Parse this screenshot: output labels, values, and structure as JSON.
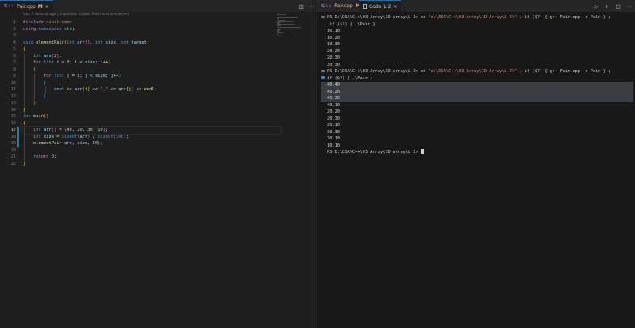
{
  "editor": {
    "tab": {
      "title": "Pair.cpp",
      "badge": "M",
      "lang_label": "C++"
    },
    "blame": "You, 1 second ago | 2 authors (Ujjwal Patel and one other)",
    "line_numbers": [
      "1",
      "2",
      "3",
      "4",
      "5",
      "6",
      "7",
      "8",
      "9",
      "10",
      "11",
      "12",
      "13",
      "14",
      "15",
      "16",
      "17",
      "18",
      "19",
      "20",
      "21",
      "22"
    ],
    "code": {
      "l1_a": "#include",
      "l1_b": " <iostream>",
      "l2_a": "using",
      "l2_b": " namespace",
      "l2_c": " std",
      "l4_a": "void",
      "l4_b": " elementPair",
      "l4_c": "int",
      "l4_d": " arr",
      "l4_e": "int",
      "l4_f": " size",
      "l4_g": "int",
      "l4_h": " target",
      "l6_a": "int",
      "l6_b": " ans",
      "l6_c": "2",
      "l7_a": "for",
      "l7_b": "int",
      "l7_c": " i",
      "l7_d": "0",
      "l7_e": " i",
      "l7_f": " size",
      "l7_g": " i",
      "l9_a": "for",
      "l9_b": "int",
      "l9_c": " j",
      "l9_d": " i",
      "l9_e": " j",
      "l9_f": " size",
      "l9_g": " j",
      "l11_a": "cout",
      "l11_b": " arr",
      "l11_c": "i",
      "l11_d": " \",\"",
      "l11_e": " arr",
      "l11_f": "j",
      "l11_g": " endl",
      "l15_a": "int",
      "l15_b": " main",
      "l17_a": "int",
      "l17_b": " arr",
      "l17_c": "40",
      "l17_d": "20",
      "l17_e": "30",
      "l17_f": "10",
      "l18_a": "int",
      "l18_b": " size",
      "l18_c": " sizeof",
      "l18_d": "arr",
      "l18_e": " sizeof",
      "l18_f": "int",
      "l19_a": "elementPair",
      "l19_b": "arr",
      "l19_c": " size",
      "l19_d": " 50",
      "l21_a": "return",
      "l21_b": " 0"
    }
  },
  "terminal": {
    "tab": {
      "title": "Code",
      "badge": "L 2"
    },
    "prompt": "PS D:\\DSA\\C++\\03 Array\\1D Array\\L 2>",
    "cmd_cd": "cd",
    "cmd_path": "\"d:\\DSA\\C++\\03 Array\\1D Array\\L 2\\\"",
    "cmd_mid": "; if ($?) {",
    "cmd_gpp": "g++",
    "cmd_compile": "Pair.cpp -o Pair } ;",
    "cmd_if2": "if ($?) {",
    "cmd_run": ".\\Pair",
    "cmd_end": "}",
    "run1": [
      "10,10",
      "10,20",
      "10,30",
      "20,20",
      "20,30",
      "30,30"
    ],
    "run2": [
      "40,40",
      "40,20",
      "40,30",
      "40,10",
      "20,20",
      "20,30",
      "20,10",
      "30,30",
      "30,10",
      "10,10"
    ]
  }
}
